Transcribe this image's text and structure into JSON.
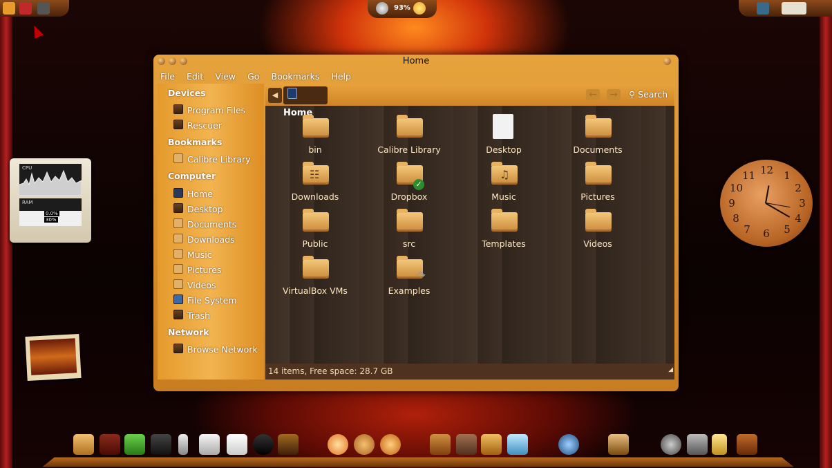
{
  "window": {
    "title": "Home",
    "menu": [
      "File",
      "Edit",
      "View",
      "Go",
      "Bookmarks",
      "Help"
    ]
  },
  "sidebar": {
    "devices_head": "Devices",
    "devices": [
      "Program Files",
      "Rescuer"
    ],
    "bookmarks_head": "Bookmarks",
    "bookmarks": [
      "Calibre Library"
    ],
    "computer_head": "Computer",
    "computer": [
      "Home",
      "Desktop",
      "Documents",
      "Downloads",
      "Music",
      "Pictures",
      "Videos",
      "File System",
      "Trash"
    ],
    "network_head": "Network",
    "network": [
      "Browse Network"
    ]
  },
  "toolbar": {
    "back_icon": "chevron-left-icon",
    "breadcrumb": "Home",
    "search_label": "Search"
  },
  "items": [
    {
      "label": "bin",
      "icon": "folder"
    },
    {
      "label": "Calibre Library",
      "icon": "folder"
    },
    {
      "label": "Desktop",
      "icon": "document"
    },
    {
      "label": "Documents",
      "icon": "folder-documents"
    },
    {
      "label": "Downloads",
      "icon": "folder-downloads"
    },
    {
      "label": "Dropbox",
      "icon": "folder-dropbox"
    },
    {
      "label": "Music",
      "icon": "folder-music"
    },
    {
      "label": "Pictures",
      "icon": "folder-pictures"
    },
    {
      "label": "Public",
      "icon": "folder"
    },
    {
      "label": "src",
      "icon": "folder"
    },
    {
      "label": "Templates",
      "icon": "folder"
    },
    {
      "label": "Videos",
      "icon": "folder-videos"
    },
    {
      "label": "VirtualBox VMs",
      "icon": "folder"
    },
    {
      "label": "Examples",
      "icon": "folder-link"
    }
  ],
  "status": "14 items, Free space: 28.7 GB",
  "tray": {
    "battery": "93%"
  },
  "cpu_widget": {
    "cpu_label": "CPU",
    "ram_label": "RAM",
    "cpu_value": "0.0%",
    "ram_value": "30%"
  },
  "clock": {
    "numbers": [
      "12",
      "1",
      "2",
      "3",
      "4",
      "5",
      "6",
      "7",
      "8",
      "9",
      "10",
      "11"
    ]
  },
  "colors": {
    "window_wood": "#e6a33c",
    "content_wood": "#3a2c22",
    "label_text": "#ffe9c4"
  }
}
